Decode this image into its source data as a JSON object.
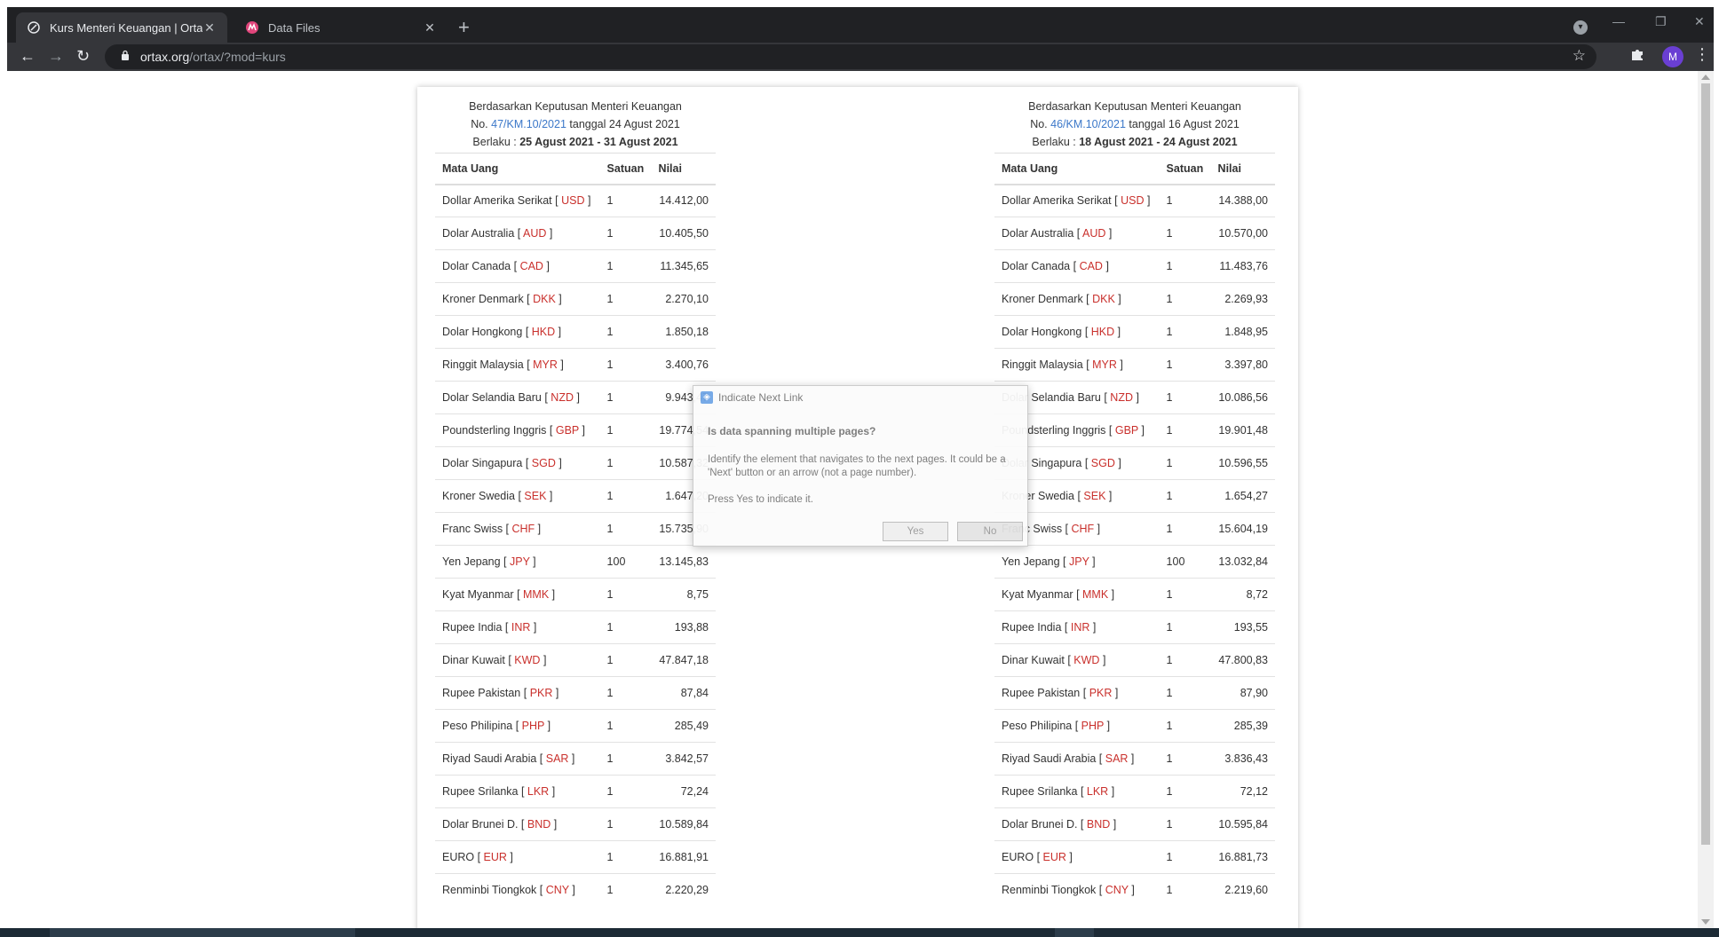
{
  "browser": {
    "tabs": [
      {
        "title": "Kurs Menteri Keuangan | Ortax -",
        "active": true,
        "icon": "ortax-favicon"
      },
      {
        "title": "Data Files",
        "active": false,
        "icon": "data-files-favicon"
      }
    ],
    "url_host": "ortax.org",
    "url_path": "/ortax/?mod=kurs",
    "profile_initial": "M"
  },
  "panels": [
    {
      "heading": "Berdasarkan Keputusan Menteri Keuangan",
      "no_prefix": "No. ",
      "decree_link": "47/KM.10/2021",
      "date_text": " tanggal 24 Agust 2021",
      "berlaku_label": "Berlaku : ",
      "berlaku_range": "25 Agust 2021 - 31 Agust 2021",
      "columns": [
        "Mata Uang",
        "Satuan",
        "Nilai"
      ],
      "rows": [
        {
          "name": "Dollar Amerika Serikat",
          "code": "USD",
          "unit": "1",
          "value": "14.412,00"
        },
        {
          "name": "Dolar Australia",
          "code": "AUD",
          "unit": "1",
          "value": "10.405,50"
        },
        {
          "name": "Dolar Canada",
          "code": "CAD",
          "unit": "1",
          "value": "11.345,65"
        },
        {
          "name": "Kroner Denmark",
          "code": "DKK",
          "unit": "1",
          "value": "2.270,10"
        },
        {
          "name": "Dolar Hongkong",
          "code": "HKD",
          "unit": "1",
          "value": "1.850,18"
        },
        {
          "name": "Ringgit Malaysia",
          "code": "MYR",
          "unit": "1",
          "value": "3.400,76"
        },
        {
          "name": "Dolar Selandia Baru",
          "code": "NZD",
          "unit": "1",
          "value": "9.943,47"
        },
        {
          "name": "Poundsterling Inggris",
          "code": "GBP",
          "unit": "1",
          "value": "19.774,54"
        },
        {
          "name": "Dolar Singapura",
          "code": "SGD",
          "unit": "1",
          "value": "10.587,32"
        },
        {
          "name": "Kroner Swedia",
          "code": "SEK",
          "unit": "1",
          "value": "1.647,20"
        },
        {
          "name": "Franc Swiss",
          "code": "CHF",
          "unit": "1",
          "value": "15.735,90"
        },
        {
          "name": "Yen Jepang",
          "code": "JPY",
          "unit": "100",
          "value": "13.145,83"
        },
        {
          "name": "Kyat Myanmar",
          "code": "MMK",
          "unit": "1",
          "value": "8,75"
        },
        {
          "name": "Rupee India",
          "code": "INR",
          "unit": "1",
          "value": "193,88"
        },
        {
          "name": "Dinar Kuwait",
          "code": "KWD",
          "unit": "1",
          "value": "47.847,18"
        },
        {
          "name": "Rupee Pakistan",
          "code": "PKR",
          "unit": "1",
          "value": "87,84"
        },
        {
          "name": "Peso Philipina",
          "code": "PHP",
          "unit": "1",
          "value": "285,49"
        },
        {
          "name": "Riyad Saudi Arabia",
          "code": "SAR",
          "unit": "1",
          "value": "3.842,57"
        },
        {
          "name": "Rupee Srilanka",
          "code": "LKR",
          "unit": "1",
          "value": "72,24"
        },
        {
          "name": "Dolar Brunei D.",
          "code": "BND",
          "unit": "1",
          "value": "10.589,84"
        },
        {
          "name": "EURO",
          "code": "EUR",
          "unit": "1",
          "value": "16.881,91"
        },
        {
          "name": "Renminbi Tiongkok",
          "code": "CNY",
          "unit": "1",
          "value": "2.220,29"
        }
      ]
    },
    {
      "heading": "Berdasarkan Keputusan Menteri Keuangan",
      "no_prefix": "No. ",
      "decree_link": "46/KM.10/2021",
      "date_text": " tanggal 16 Agust 2021",
      "berlaku_label": "Berlaku : ",
      "berlaku_range": "18 Agust 2021 - 24 Agust 2021",
      "columns": [
        "Mata Uang",
        "Satuan",
        "Nilai"
      ],
      "rows": [
        {
          "name": "Dollar Amerika Serikat",
          "code": "USD",
          "unit": "1",
          "value": "14.388,00"
        },
        {
          "name": "Dolar Australia",
          "code": "AUD",
          "unit": "1",
          "value": "10.570,00"
        },
        {
          "name": "Dolar Canada",
          "code": "CAD",
          "unit": "1",
          "value": "11.483,76"
        },
        {
          "name": "Kroner Denmark",
          "code": "DKK",
          "unit": "1",
          "value": "2.269,93"
        },
        {
          "name": "Dolar Hongkong",
          "code": "HKD",
          "unit": "1",
          "value": "1.848,95"
        },
        {
          "name": "Ringgit Malaysia",
          "code": "MYR",
          "unit": "1",
          "value": "3.397,80"
        },
        {
          "name": "Dolar Selandia Baru",
          "code": "NZD",
          "unit": "1",
          "value": "10.086,56"
        },
        {
          "name": "Poundsterling Inggris",
          "code": "GBP",
          "unit": "1",
          "value": "19.901,48"
        },
        {
          "name": "Dolar Singapura",
          "code": "SGD",
          "unit": "1",
          "value": "10.596,55"
        },
        {
          "name": "Kroner Swedia",
          "code": "SEK",
          "unit": "1",
          "value": "1.654,27"
        },
        {
          "name": "Franc Swiss",
          "code": "CHF",
          "unit": "1",
          "value": "15.604,19"
        },
        {
          "name": "Yen Jepang",
          "code": "JPY",
          "unit": "100",
          "value": "13.032,84"
        },
        {
          "name": "Kyat Myanmar",
          "code": "MMK",
          "unit": "1",
          "value": "8,72"
        },
        {
          "name": "Rupee India",
          "code": "INR",
          "unit": "1",
          "value": "193,55"
        },
        {
          "name": "Dinar Kuwait",
          "code": "KWD",
          "unit": "1",
          "value": "47.800,83"
        },
        {
          "name": "Rupee Pakistan",
          "code": "PKR",
          "unit": "1",
          "value": "87,90"
        },
        {
          "name": "Peso Philipina",
          "code": "PHP",
          "unit": "1",
          "value": "285,39"
        },
        {
          "name": "Riyad Saudi Arabia",
          "code": "SAR",
          "unit": "1",
          "value": "3.836,43"
        },
        {
          "name": "Rupee Srilanka",
          "code": "LKR",
          "unit": "1",
          "value": "72,12"
        },
        {
          "name": "Dolar Brunei D.",
          "code": "BND",
          "unit": "1",
          "value": "10.595,84"
        },
        {
          "name": "EURO",
          "code": "EUR",
          "unit": "1",
          "value": "16.881,73"
        },
        {
          "name": "Renminbi Tiongkok",
          "code": "CNY",
          "unit": "1",
          "value": "2.219,60"
        }
      ]
    }
  ],
  "dialog": {
    "title": "Indicate Next Link",
    "question": "Is data spanning multiple pages?",
    "description": "Identify the element that navigates to the next pages. It could be a 'Next' button or an arrow (not a page number).",
    "instruction": "Press Yes to indicate it.",
    "yes_label": "Yes",
    "no_label": "No"
  }
}
